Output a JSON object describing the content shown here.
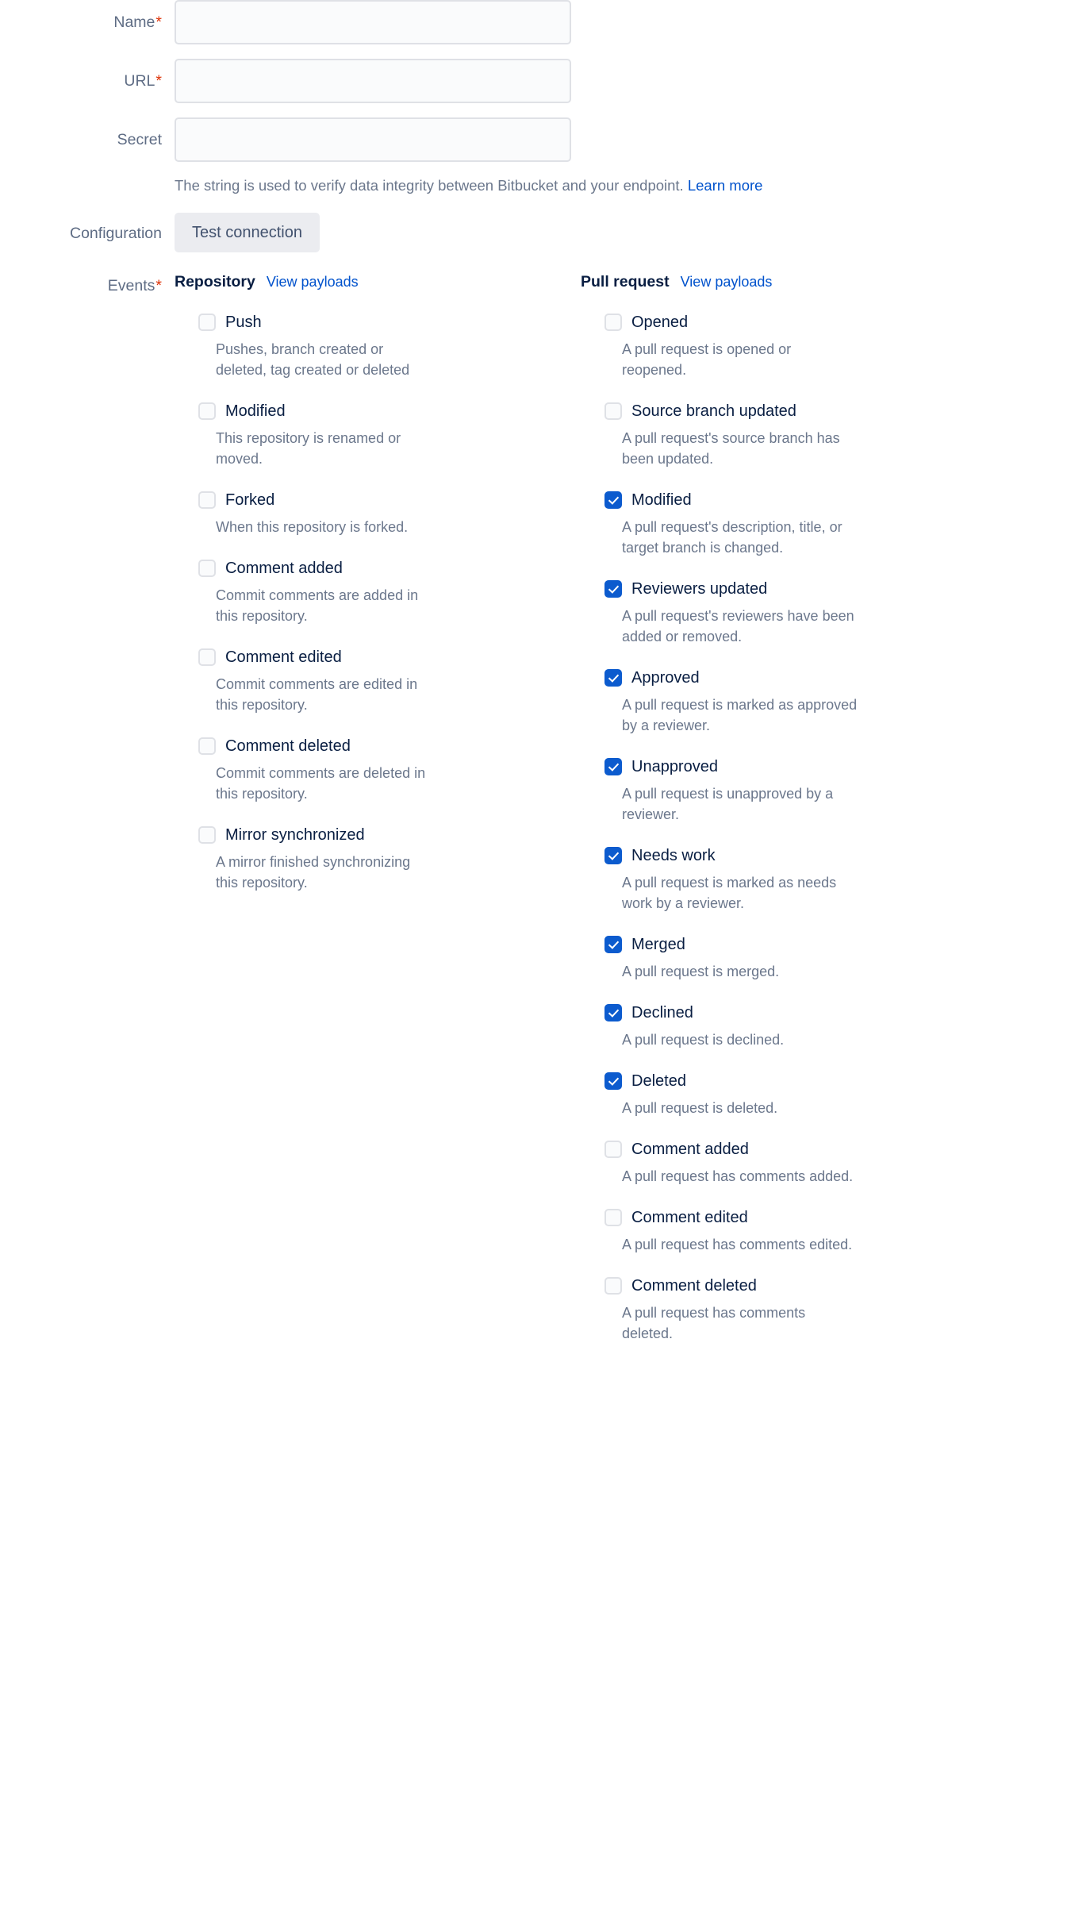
{
  "fields": [
    {
      "label": "Name",
      "required": true,
      "value": "",
      "placeholder": ""
    },
    {
      "label": "URL",
      "required": true,
      "value": "",
      "placeholder": ""
    },
    {
      "label": "Secret",
      "required": false,
      "value": "",
      "placeholder": ""
    }
  ],
  "secret_helper": {
    "text": "The string is used to verify data integrity between Bitbucket and your endpoint.",
    "link_label": "Learn more"
  },
  "configuration": {
    "label": "Configuration",
    "test_connection_label": "Test connection"
  },
  "events": {
    "label": "Events",
    "required": true,
    "columns": [
      {
        "title": "Repository",
        "view_payloads_label": "View payloads",
        "items": [
          {
            "label": "Push",
            "description": "Pushes, branch created or deleted, tag created or deleted",
            "checked": false
          },
          {
            "label": "Modified",
            "description": "This repository is renamed or moved.",
            "checked": false
          },
          {
            "label": "Forked",
            "description": "When this repository is forked.",
            "checked": false
          },
          {
            "label": "Comment added",
            "description": "Commit comments are added in this repository.",
            "checked": false
          },
          {
            "label": "Comment edited",
            "description": "Commit comments are edited in this repository.",
            "checked": false
          },
          {
            "label": "Comment deleted",
            "description": "Commit comments are deleted in this repository.",
            "checked": false
          },
          {
            "label": "Mirror synchronized",
            "description": "A mirror finished synchronizing this repository.",
            "checked": false
          }
        ]
      },
      {
        "title": "Pull request",
        "view_payloads_label": "View payloads",
        "items": [
          {
            "label": "Opened",
            "description": "A pull request is opened or reopened.",
            "checked": false
          },
          {
            "label": "Source branch updated",
            "description": "A pull request's source branch has been updated.",
            "checked": false
          },
          {
            "label": "Modified",
            "description": "A pull request's description, title, or target branch is changed.",
            "checked": true
          },
          {
            "label": "Reviewers updated",
            "description": "A pull request's reviewers have been added or removed.",
            "checked": true
          },
          {
            "label": "Approved",
            "description": "A pull request is marked as approved by a reviewer.",
            "checked": true
          },
          {
            "label": "Unapproved",
            "description": "A pull request is unapproved by a reviewer.",
            "checked": true
          },
          {
            "label": "Needs work",
            "description": "A pull request is marked as needs work by a reviewer.",
            "checked": true
          },
          {
            "label": "Merged",
            "description": "A pull request is merged.",
            "checked": true
          },
          {
            "label": "Declined",
            "description": "A pull request is declined.",
            "checked": true
          },
          {
            "label": "Deleted",
            "description": "A pull request is deleted.",
            "checked": true
          },
          {
            "label": "Comment added",
            "description": "A pull request has comments added.",
            "checked": false
          },
          {
            "label": "Comment edited",
            "description": "A pull request has comments edited.",
            "checked": false
          },
          {
            "label": "Comment deleted",
            "description": "A pull request has comments deleted.",
            "checked": false
          }
        ]
      }
    ]
  },
  "colors": {
    "accent_link": "#0052CC",
    "checkbox_checked": "#0C5BCE",
    "required_asterisk": "#DE350B",
    "label_text": "#5E6C84",
    "description_text": "#6B778C",
    "input_bg": "#FAFBFC",
    "input_border": "#DFE1E6",
    "button_bg": "#EBECF0"
  }
}
